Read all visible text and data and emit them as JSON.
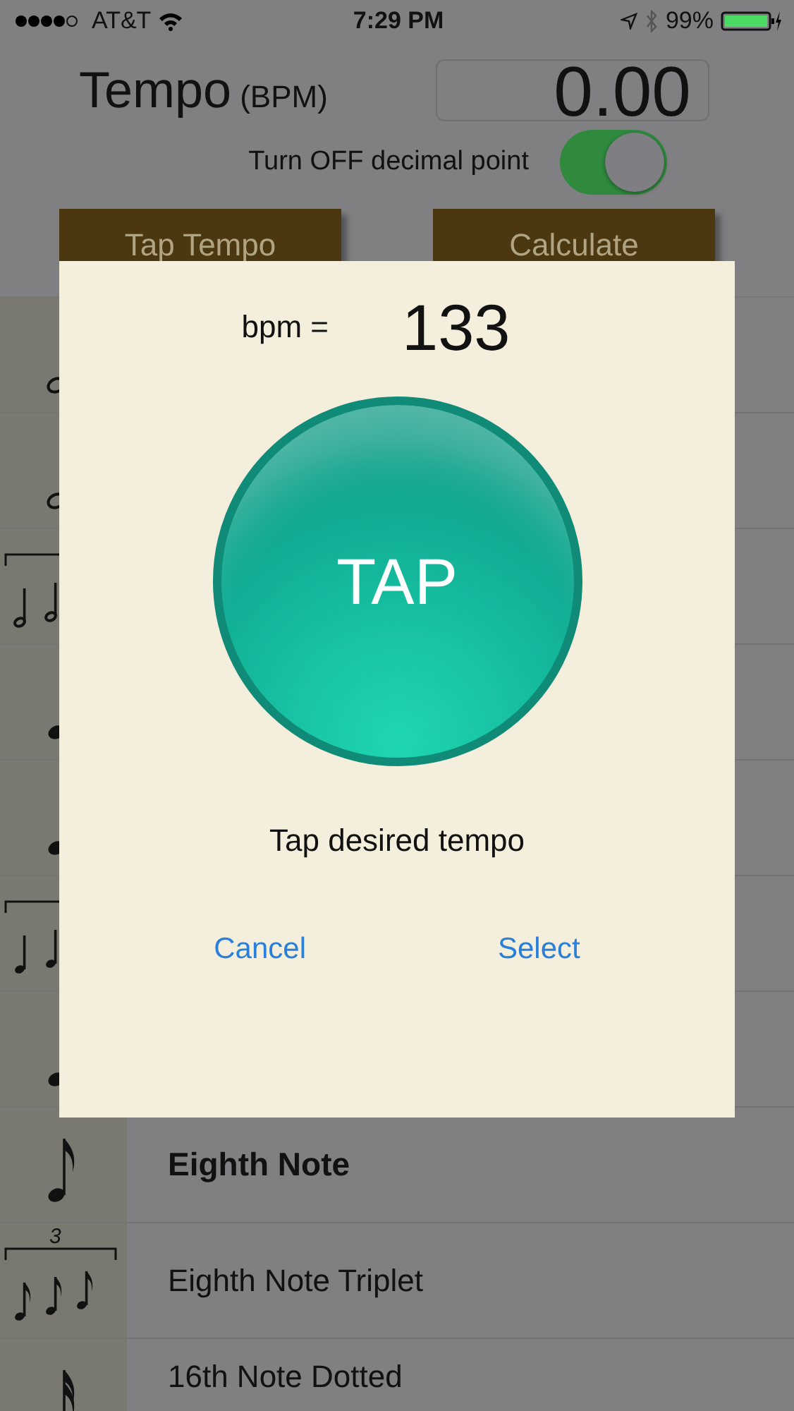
{
  "status_bar": {
    "carrier": "AT&T",
    "time": "7:29 PM",
    "battery": "99%"
  },
  "header": {
    "title": "Tempo",
    "unit": "(BPM)",
    "value": "0.00"
  },
  "decimal_toggle": {
    "label": "Turn OFF decimal point",
    "on": true
  },
  "buttons": [
    "Tap Tempo",
    "Calculate"
  ],
  "note_rows": [
    {
      "kind": "half"
    },
    {
      "kind": "half"
    },
    {
      "kind": "half-triplet"
    },
    {
      "kind": "quarter"
    },
    {
      "kind": "quarter"
    },
    {
      "kind": "quarter-triplet"
    },
    {
      "kind": "quarter"
    },
    {
      "kind": "eighth",
      "label": "Eighth Note",
      "selected": true
    },
    {
      "kind": "eighth-triplet",
      "label": "Eighth Note Triplet",
      "tuplet": "3",
      "selected": false
    },
    {
      "kind": "sixteenth",
      "label": "16th Note Dotted",
      "selected": false
    }
  ],
  "tap_dialog": {
    "bpm_label": "bpm =",
    "bpm_value": "133",
    "tap_button": "TAP",
    "hint": "Tap desired tempo",
    "actions": [
      "Cancel",
      "Select"
    ]
  }
}
